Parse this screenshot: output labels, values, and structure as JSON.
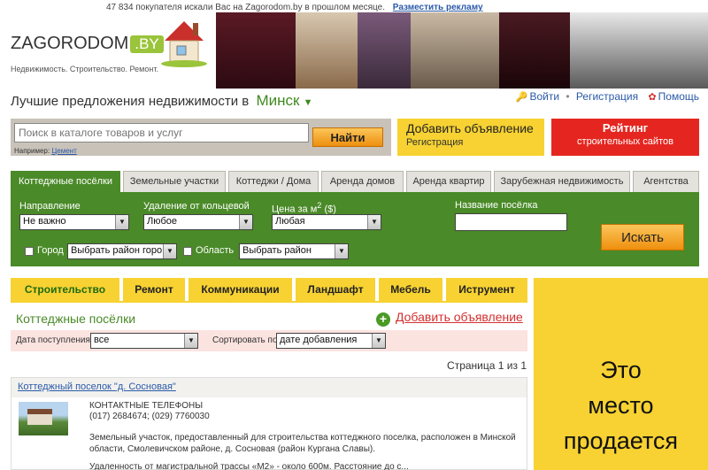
{
  "topbar": {
    "visitors_text": "47 834 покупателя искали Вас на Zagorodom.by в прошлом месяце.",
    "advertise_link": "Разместить рекламу"
  },
  "logo": {
    "name": "ZAGORODOM",
    "tld": ".BY",
    "tagline": "Недвижимость. Строительство. Ремонт."
  },
  "header": {
    "headline": "Лучшие предложения недвижимости в",
    "city": "Минск",
    "login": "Войти",
    "register": "Регистрация",
    "help": "Помощь"
  },
  "search": {
    "placeholder": "Поиск в каталоге товаров и услуг",
    "button": "Найти",
    "hint_prefix": "Например:",
    "hint_link": "Цемент"
  },
  "add_ad": {
    "title": "Добавить объявление",
    "subtitle": "Регистрация"
  },
  "rating": {
    "title": "Рейтинг",
    "subtitle": "строительных сайтов"
  },
  "tabs": [
    {
      "label": "Коттеджные посёлки",
      "active": true
    },
    {
      "label": "Земельные участки"
    },
    {
      "label": "Коттеджи / Дома"
    },
    {
      "label": "Аренда домов"
    },
    {
      "label": "Аренда квартир"
    },
    {
      "label": "Зарубежная недвижимость"
    },
    {
      "label": "Агентства"
    }
  ],
  "filter": {
    "direction_label": "Направление",
    "direction_value": "Не важно",
    "distance_label": "Удаление от кольцевой",
    "distance_value": "Любое",
    "price_label": "Цена за м",
    "price_sup": "2",
    "price_unit": "($)",
    "price_value": "Любая",
    "name_label": "Название посёлка",
    "city_label": "Город",
    "city_value": "Выбрать район горо",
    "region_label": "Область",
    "region_value": "Выбрать район",
    "show_button": "Искать"
  },
  "categories": [
    {
      "label": "Строительство",
      "active": true
    },
    {
      "label": "Ремонт"
    },
    {
      "label": "Коммуникации"
    },
    {
      "label": "Ландшафт"
    },
    {
      "label": "Мебель"
    },
    {
      "label": "Иструмент"
    }
  ],
  "section": {
    "title": "Коттеджные посёлки",
    "add_link": "Добавить объявление",
    "date_label": "Дата поступления",
    "date_value": "все",
    "sort_label": "Сортировать по",
    "sort_value": "дате добавления",
    "page_info": "Страница 1 из 1"
  },
  "listing": {
    "title": "Коттеджный поселок \"д. Сосновая\"",
    "contacts_label": "КОНТАКТНЫЕ ТЕЛЕФОНЫ",
    "phones": "(017) 2684674; (029) 7760030",
    "desc_line1": "Земельный участок, предоставленный для строительства коттеджного поселка, расположен в Минской",
    "desc_line2": "области, Смолевичском районе, д. Сосновая (район Кургана Славы).",
    "desc_line3": "Удаленность от магистральной трассы «М2» - около 600м. Расстояние до с..."
  },
  "ad": {
    "line1": "Это",
    "line2": "место",
    "line3": "продается"
  },
  "colors": {
    "green": "#4a8a28",
    "yellow": "#f7d232",
    "red": "#e52620",
    "link": "#2a5aa8"
  }
}
